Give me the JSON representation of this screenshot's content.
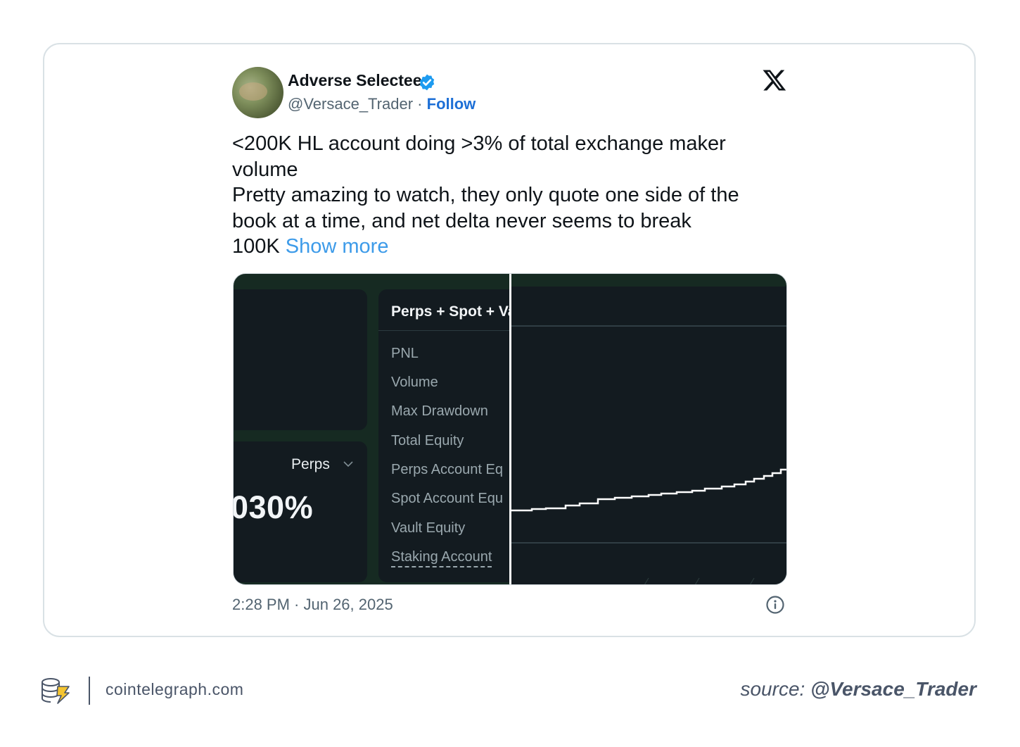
{
  "tweet": {
    "author_name": "Adverse Selectee",
    "handle": "@Versace_Trader",
    "separator": "·",
    "follow_label": "Follow",
    "text_lines": [
      "<200K HL account doing >3% of total exchange maker",
      "volume",
      "Pretty amazing to watch, they only quote one side of the",
      "book at a time, and net delta never seems to break",
      "100K"
    ],
    "show_more_label": "Show more",
    "timestamp": "2:28 PM · Jun 26, 2025"
  },
  "media": {
    "perps_label": "Perps",
    "big_percent": "030%",
    "panel_header": "Perps + Spot + Va",
    "metrics": [
      "PNL",
      "Volume",
      "Max Drawdown",
      "Total Equity",
      "Perps Account Eq",
      "Spot Account Equ",
      "Vault Equity",
      "Staking Account"
    ]
  },
  "footer": {
    "site": "cointelegraph.com",
    "source_prefix": "source:",
    "source_handle": "@Versace_Trader"
  },
  "icons": {
    "verified": "verified-badge-icon",
    "x_logo": "x-logo-icon",
    "info": "info-icon",
    "chevron": "chevron-down-icon",
    "brand": "cointelegraph-logo-icon"
  },
  "colors": {
    "follow": "#1d6fd6",
    "show_more": "#3d9be9",
    "verified": "#1d9bf0",
    "media_bg": "#162a22",
    "panel_bg": "#131b20",
    "brand_accent": "#f4c430"
  }
}
